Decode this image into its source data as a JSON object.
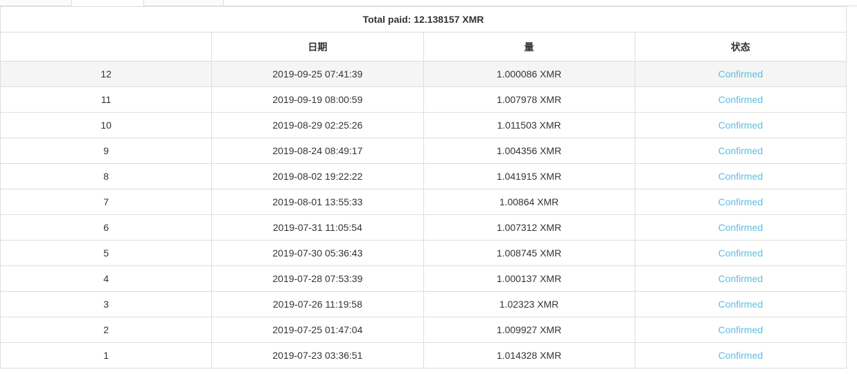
{
  "tabs": [
    {
      "name": "tab-left",
      "label": "",
      "active": false
    },
    {
      "name": "tab-middle",
      "label": "",
      "active": true
    },
    {
      "name": "tab-right",
      "label": "",
      "active": false
    }
  ],
  "summary": {
    "total_paid_label": "Total paid: 12.138157 XMR",
    "total_paid_amount": "12.138157",
    "currency": "XMR"
  },
  "table": {
    "columns": {
      "index": "",
      "date": "日期",
      "amount": "量",
      "status": "状态"
    },
    "rows": [
      {
        "index": "12",
        "date": "2019-09-25 07:41:39",
        "amount": "1.000086 XMR",
        "status": "Confirmed"
      },
      {
        "index": "11",
        "date": "2019-09-19 08:00:59",
        "amount": "1.007978 XMR",
        "status": "Confirmed"
      },
      {
        "index": "10",
        "date": "2019-08-29 02:25:26",
        "amount": "1.011503 XMR",
        "status": "Confirmed"
      },
      {
        "index": "9",
        "date": "2019-08-24 08:49:17",
        "amount": "1.004356 XMR",
        "status": "Confirmed"
      },
      {
        "index": "8",
        "date": "2019-08-02 19:22:22",
        "amount": "1.041915 XMR",
        "status": "Confirmed"
      },
      {
        "index": "7",
        "date": "2019-08-01 13:55:33",
        "amount": "1.00864 XMR",
        "status": "Confirmed"
      },
      {
        "index": "6",
        "date": "2019-07-31 11:05:54",
        "amount": "1.007312 XMR",
        "status": "Confirmed"
      },
      {
        "index": "5",
        "date": "2019-07-30 05:36:43",
        "amount": "1.008745 XMR",
        "status": "Confirmed"
      },
      {
        "index": "4",
        "date": "2019-07-28 07:53:39",
        "amount": "1.000137 XMR",
        "status": "Confirmed"
      },
      {
        "index": "3",
        "date": "2019-07-26 11:19:58",
        "amount": "1.02323 XMR",
        "status": "Confirmed"
      },
      {
        "index": "2",
        "date": "2019-07-25 01:47:04",
        "amount": "1.009927 XMR",
        "status": "Confirmed"
      },
      {
        "index": "1",
        "date": "2019-07-23 03:36:51",
        "amount": "1.014328 XMR",
        "status": "Confirmed"
      }
    ],
    "hovered_row_index": 0
  },
  "colors": {
    "link": "#5bc0de",
    "border": "#dddddd",
    "row_hover": "#f5f5f5",
    "text": "#333333"
  }
}
